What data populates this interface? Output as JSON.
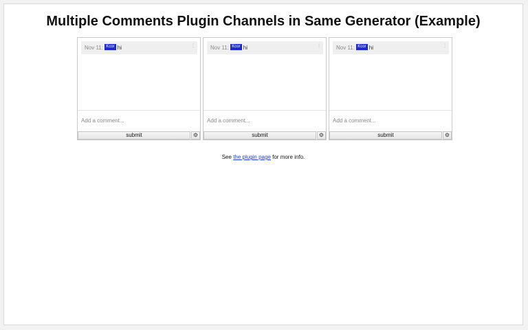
{
  "page": {
    "title": "Multiple Comments Plugin Channels in Same Generator (Example)"
  },
  "channels": [
    {
      "comment": {
        "date": "Nov 11:",
        "user": "Kcor",
        "text": "hi",
        "menu_icon": "more-vertical-icon"
      },
      "input_placeholder": "Add a comment...",
      "submit_label": "submit",
      "settings_icon": "⚙"
    },
    {
      "comment": {
        "date": "Nov 11:",
        "user": "Kcor",
        "text": "hi",
        "menu_icon": "more-vertical-icon"
      },
      "input_placeholder": "Add a comment...",
      "submit_label": "submit",
      "settings_icon": "⚙"
    },
    {
      "comment": {
        "date": "Nov 11:",
        "user": "Kcor",
        "text": "hi",
        "menu_icon": "more-vertical-icon"
      },
      "input_placeholder": "Add a comment...",
      "submit_label": "submit",
      "settings_icon": "⚙"
    }
  ],
  "footer": {
    "prefix": "See ",
    "link_text": "the plugin page",
    "suffix": " for more info."
  },
  "colors": {
    "user_badge": "#1c2bd1",
    "link": "#1a3fd8"
  }
}
